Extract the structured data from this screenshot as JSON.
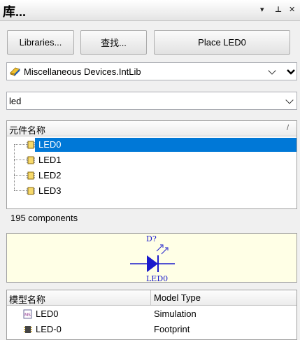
{
  "panel": {
    "title": "库...",
    "menu_glyph": "▾",
    "pin_glyph": "⊥",
    "close_glyph": "✕"
  },
  "toolbar": {
    "libraries_label": "Libraries...",
    "search_label": "查找...",
    "place_label": "Place LED0"
  },
  "library_select": {
    "value": "Miscellaneous Devices.IntLib"
  },
  "filter_input": {
    "value": "led"
  },
  "components": {
    "header": "元件名称",
    "sort_glyph": "/",
    "items": [
      {
        "label": "LED0",
        "selected": true
      },
      {
        "label": "LED1",
        "selected": false
      },
      {
        "label": "LED2",
        "selected": false
      },
      {
        "label": "LED3",
        "selected": false
      }
    ],
    "count_text": "195 components"
  },
  "symbol": {
    "designator": "D?",
    "comment": "LED0",
    "color": "#1a1acc"
  },
  "models": {
    "col_name": "模型名称",
    "col_type": "Model Type",
    "rows": [
      {
        "name": "LED0",
        "type": "Simulation",
        "icon": "simulation-model-icon"
      },
      {
        "name": "LED-0",
        "type": "Footprint",
        "icon": "footprint-model-icon"
      }
    ]
  },
  "colors": {
    "selection": "#0078d7",
    "preview_bg": "#ffffe6"
  }
}
